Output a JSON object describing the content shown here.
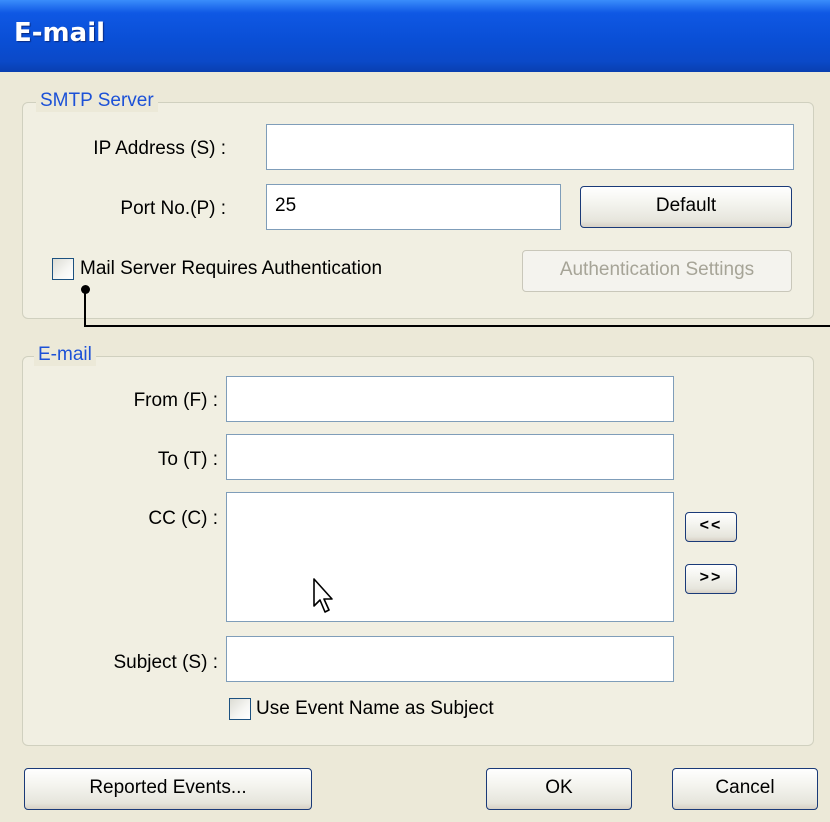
{
  "window": {
    "title": "E-mail"
  },
  "smtp": {
    "legend": "SMTP Server",
    "ip_label": "IP Address (S) :",
    "ip_value": "",
    "port_label": "Port No.(P) :",
    "port_value": "25",
    "default_button": "Default",
    "auth_checkbox_label": "Mail Server Requires Authentication",
    "auth_checked": false,
    "auth_settings_button": "Authentication Settings"
  },
  "email": {
    "legend": "E-mail",
    "from_label": "From (F) :",
    "from_value": "",
    "to_label": "To (T) :",
    "to_value": "",
    "cc_label": "CC (C) :",
    "cc_value": "",
    "add_button": "<<",
    "remove_button": ">>",
    "subject_label": "Subject (S) :",
    "subject_value": "",
    "use_event_label": "Use Event Name as Subject",
    "use_event_checked": false
  },
  "footer": {
    "reported_events_button": "Reported Events...",
    "ok_button": "OK",
    "cancel_button": "Cancel"
  },
  "colors": {
    "titlebar": "#0a4fd6",
    "dialog_bg": "#ece9d8",
    "legend_text": "#1c51d7"
  },
  "icons": {
    "cursor": "arrow-cursor-icon"
  }
}
